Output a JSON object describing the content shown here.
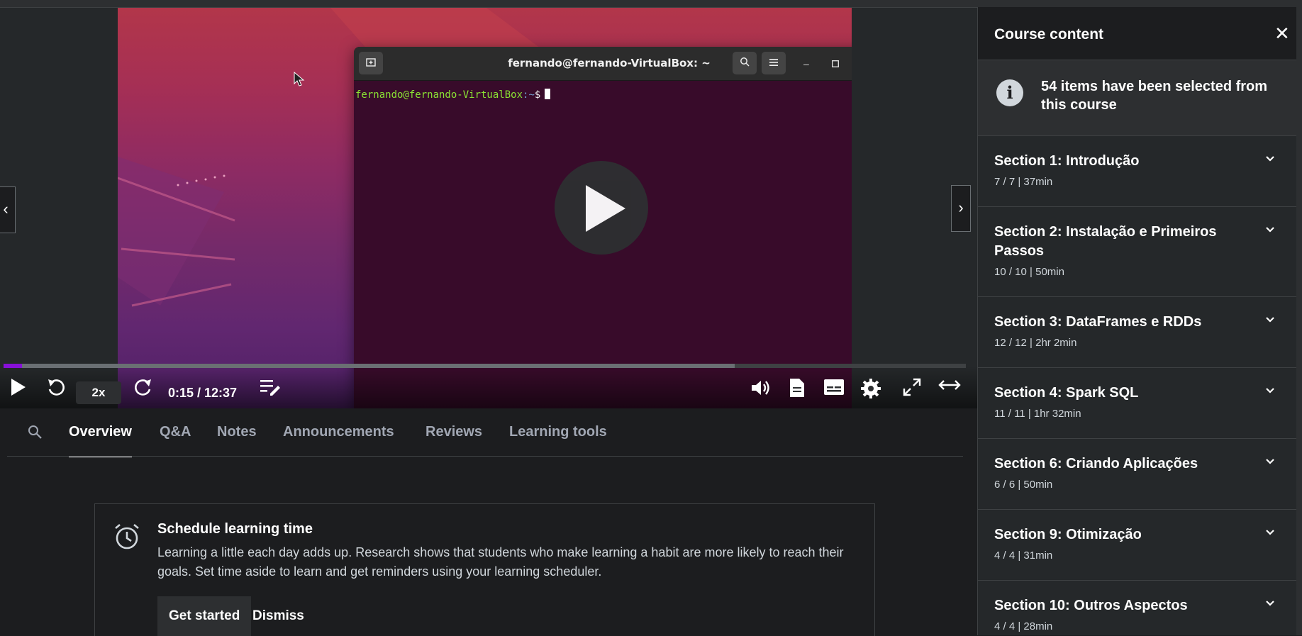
{
  "terminal": {
    "title": "fernando@fernando-VirtualBox: ~",
    "prompt_user": "fernando@fernando-VirtualBox",
    "prompt_path": ":~",
    "prompt_symbol": "$"
  },
  "player": {
    "speed": "2x",
    "time": "0:15 / 12:37",
    "progress_played_fraction": 0.019,
    "progress_buffered_fraction": 0.76,
    "accent_color": "#8710d8"
  },
  "tabs": [
    "Overview",
    "Q&A",
    "Notes",
    "Announcements",
    "Reviews",
    "Learning tools"
  ],
  "schedule": {
    "title": "Schedule learning time",
    "body": "Learning a little each day adds up. Research shows that students who make learning a habit are more likely to reach their goals. Set time aside to learn and get reminders using your learning scheduler.",
    "primary": "Get started",
    "secondary": "Dismiss"
  },
  "sidebar": {
    "title": "Course content",
    "notice": "54 items have been selected from this course",
    "sections": [
      {
        "title": "Section 1: Introdução",
        "meta": "7 / 7 | 37min"
      },
      {
        "title": "Section 2: Instalação e Primeiros Passos",
        "meta": "10 / 10 | 50min"
      },
      {
        "title": "Section 3: DataFrames e RDDs",
        "meta": "12 / 12 | 2hr 2min"
      },
      {
        "title": "Section 4: Spark SQL",
        "meta": "11 / 11 | 1hr 32min"
      },
      {
        "title": "Section 6: Criando Aplicações",
        "meta": "6 / 6 | 50min"
      },
      {
        "title": "Section 9: Otimização",
        "meta": "4 / 4 | 31min"
      },
      {
        "title": "Section 10: Outros Aspectos",
        "meta": "4 / 4 | 28min"
      }
    ]
  },
  "icons": [
    "play-icon",
    "rewind-icon",
    "forward-icon",
    "notes-icon",
    "volume-icon",
    "transcript-icon",
    "captions-icon",
    "settings-icon",
    "fullscreen-icon",
    "expand-icon",
    "search-icon",
    "alarm-clock-icon",
    "info-icon",
    "close-icon",
    "chevron-down-icon"
  ]
}
